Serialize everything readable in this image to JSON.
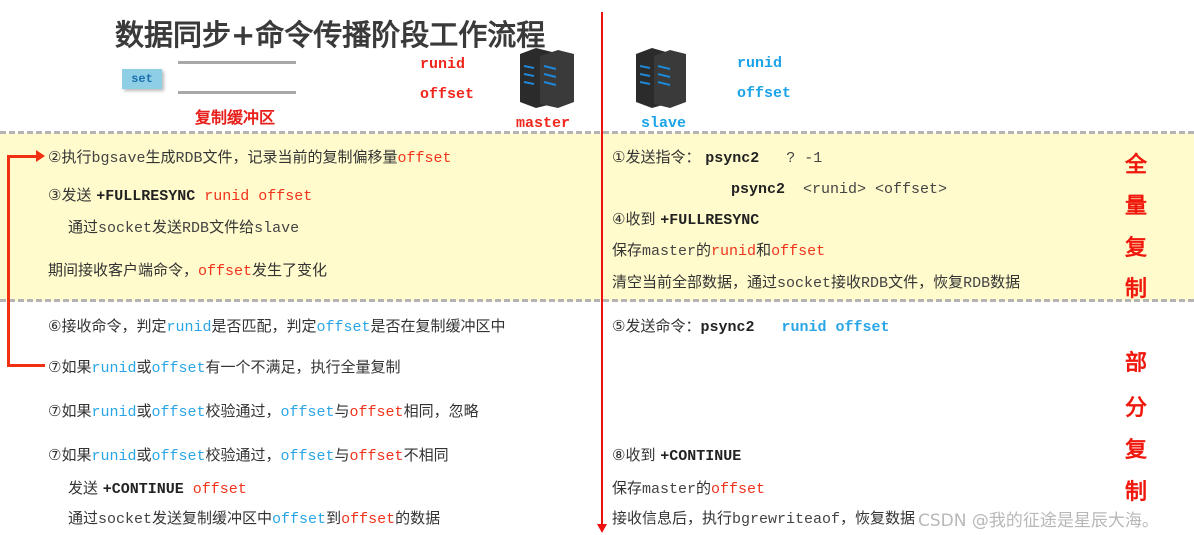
{
  "title": "数据同步+命令传播阶段工作流程",
  "buffer": {
    "set_label": "set",
    "label": "复制缓冲区"
  },
  "master": {
    "runid": "runid",
    "offset": "offset",
    "label": "master"
  },
  "slave": {
    "runid": "runid",
    "offset": "offset",
    "label": "slave"
  },
  "colors": {
    "red": "#f0341c",
    "blue": "#2aa6e6",
    "band": "#fffbcc"
  },
  "full_sync_label": [
    "全",
    "量",
    "复",
    "制"
  ],
  "partial_sync_label": [
    "部",
    "分",
    "复",
    "制"
  ],
  "watermark": "CSDN @我的征途是星辰大海。",
  "left_lines": [
    [
      {
        "t": "②执行",
        "s": ""
      },
      {
        "t": "bgsave",
        "s": "mono"
      },
      {
        "t": "生成",
        "s": ""
      },
      {
        "t": "RDB",
        "s": "mono"
      },
      {
        "t": "文件，记录当前的复制偏移量",
        "s": ""
      },
      {
        "t": "offset",
        "s": "red"
      }
    ],
    [
      {
        "t": "③发送 ",
        "s": ""
      },
      {
        "t": "+FULLRESYNC ",
        "s": "bold"
      },
      {
        "t": "runid offset",
        "s": "red"
      }
    ],
    [
      {
        "t": "通过",
        "s": ""
      },
      {
        "t": "socket",
        "s": "mono"
      },
      {
        "t": "发送",
        "s": ""
      },
      {
        "t": "RDB",
        "s": "mono"
      },
      {
        "t": "文件给",
        "s": ""
      },
      {
        "t": "slave",
        "s": "mono"
      }
    ],
    [
      {
        "t": "期间接收客户端命令，",
        "s": ""
      },
      {
        "t": "offset",
        "s": "red"
      },
      {
        "t": "发生了变化",
        "s": ""
      }
    ],
    [
      {
        "t": "⑥接收命令，判定",
        "s": ""
      },
      {
        "t": "runid",
        "s": "blue"
      },
      {
        "t": "是否匹配，判定",
        "s": ""
      },
      {
        "t": "offset",
        "s": "blue"
      },
      {
        "t": "是否在复制缓冲区中",
        "s": ""
      }
    ],
    [
      {
        "t": "⑦如果",
        "s": ""
      },
      {
        "t": "runid",
        "s": "blue"
      },
      {
        "t": "或",
        "s": ""
      },
      {
        "t": "offset",
        "s": "blue"
      },
      {
        "t": "有一个不满足，执行全量复制",
        "s": ""
      }
    ],
    [
      {
        "t": "⑦如果",
        "s": ""
      },
      {
        "t": "runid",
        "s": "blue"
      },
      {
        "t": "或",
        "s": ""
      },
      {
        "t": "offset",
        "s": "blue"
      },
      {
        "t": "校验通过，",
        "s": ""
      },
      {
        "t": "offset",
        "s": "blue"
      },
      {
        "t": "与",
        "s": ""
      },
      {
        "t": "offset",
        "s": "red"
      },
      {
        "t": "相同，忽略",
        "s": ""
      }
    ],
    [
      {
        "t": "⑦如果",
        "s": ""
      },
      {
        "t": "runid",
        "s": "blue"
      },
      {
        "t": "或",
        "s": ""
      },
      {
        "t": "offset",
        "s": "blue"
      },
      {
        "t": "校验通过，",
        "s": ""
      },
      {
        "t": "offset",
        "s": "blue"
      },
      {
        "t": "与",
        "s": ""
      },
      {
        "t": "offset",
        "s": "red"
      },
      {
        "t": "不相同",
        "s": ""
      }
    ],
    [
      {
        "t": "发送 ",
        "s": ""
      },
      {
        "t": "+CONTINUE ",
        "s": "bold"
      },
      {
        "t": "offset",
        "s": "red"
      }
    ],
    [
      {
        "t": "通过",
        "s": ""
      },
      {
        "t": "socket",
        "s": "mono"
      },
      {
        "t": "发送复制缓冲区中",
        "s": ""
      },
      {
        "t": "offset",
        "s": "blue"
      },
      {
        "t": "到",
        "s": ""
      },
      {
        "t": "offset",
        "s": "red"
      },
      {
        "t": "的数据",
        "s": ""
      }
    ]
  ],
  "right_lines": [
    [
      {
        "t": "①发送指令： ",
        "s": ""
      },
      {
        "t": "psync2",
        "s": "bold"
      },
      {
        "t": "   ? -1",
        "s": "mono"
      }
    ],
    [
      {
        "t": "psync2",
        "s": "bold"
      },
      {
        "t": "  <runid> <offset>",
        "s": "mono"
      }
    ],
    [
      {
        "t": "④收到 ",
        "s": ""
      },
      {
        "t": "+FULLRESYNC",
        "s": "bold"
      }
    ],
    [
      {
        "t": "保存",
        "s": ""
      },
      {
        "t": "master",
        "s": "mono"
      },
      {
        "t": "的",
        "s": ""
      },
      {
        "t": "runid",
        "s": "red"
      },
      {
        "t": "和",
        "s": ""
      },
      {
        "t": "offset",
        "s": "red"
      }
    ],
    [
      {
        "t": "清空当前全部数据，通过",
        "s": ""
      },
      {
        "t": "socket",
        "s": "mono"
      },
      {
        "t": "接收",
        "s": ""
      },
      {
        "t": "RDB",
        "s": "mono"
      },
      {
        "t": "文件，恢复",
        "s": ""
      },
      {
        "t": "RDB",
        "s": "mono"
      },
      {
        "t": "数据",
        "s": ""
      }
    ],
    [
      {
        "t": "⑤发送命令：",
        "s": ""
      },
      {
        "t": "psync2  ",
        "s": "bold"
      },
      {
        "t": " runid offset",
        "s": "bblue"
      }
    ],
    [
      {
        "t": "⑧收到 ",
        "s": ""
      },
      {
        "t": "+CONTINUE",
        "s": "bold"
      }
    ],
    [
      {
        "t": "保存",
        "s": ""
      },
      {
        "t": "master",
        "s": "mono"
      },
      {
        "t": "的",
        "s": ""
      },
      {
        "t": "offset",
        "s": "red"
      }
    ],
    [
      {
        "t": "接收信息后，执行",
        "s": ""
      },
      {
        "t": "bgrewriteaof",
        "s": "mono"
      },
      {
        "t": "，恢复数据",
        "s": ""
      }
    ]
  ]
}
